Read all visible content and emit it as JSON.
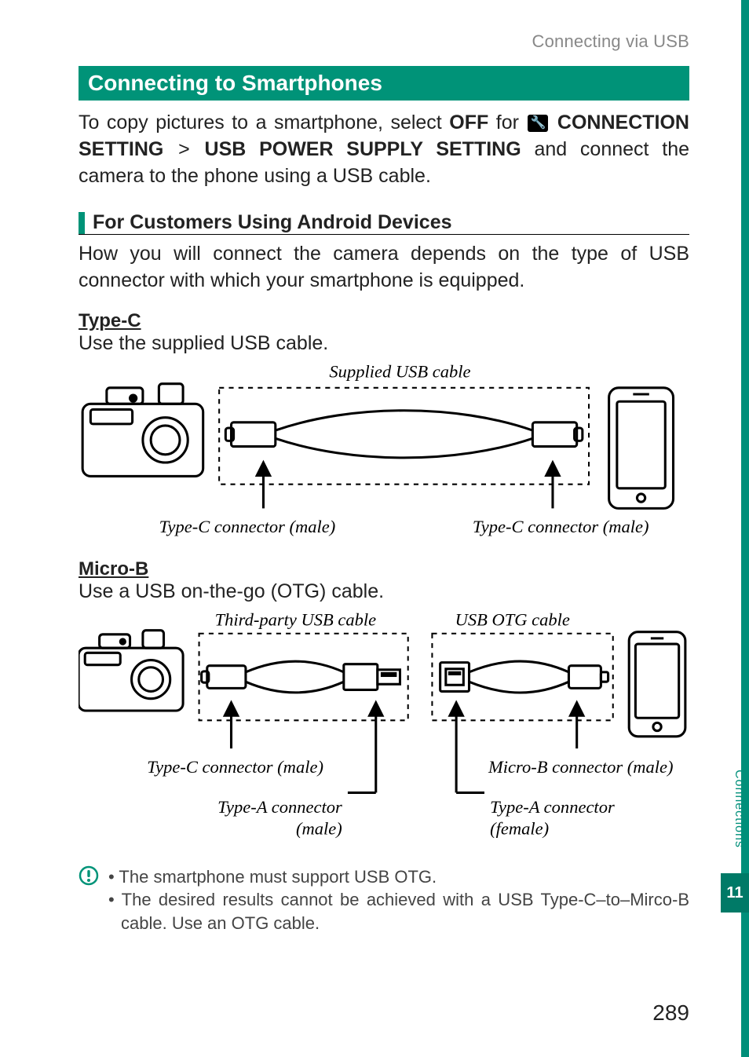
{
  "running_head": "Connecting via USB",
  "section_title": "Connecting to Smartphones",
  "intro": {
    "prefix": "To copy pictures to a smartphone, select ",
    "off": "OFF",
    "for_word": " for ",
    "menu1": "CONNECTION SETTING",
    "gt": ">",
    "menu2": "USB POWER SUPPLY SETTING",
    "suffix": " and connect the camera to the phone using a USB cable."
  },
  "android_heading": "For Customers Using Android Devices",
  "android_para": "How you will connect the camera depends on the type of USB connector with which your smartphone is equipped.",
  "type_c": {
    "title": "Type-C",
    "body": "Use the supplied USB cable.",
    "cable_label": "Supplied USB cable",
    "left_conn": "Type-C connector (male)",
    "right_conn": "Type-C connector (male)"
  },
  "micro_b": {
    "title": "Micro-B",
    "body": "Use a USB on-the-go (OTG) cable.",
    "cable1_label": "Third-party USB cable",
    "cable2_label": "USB OTG cable",
    "left_conn": "Type-C connector (male)",
    "mid_left": "Type-A connector (male)",
    "right_conn": "Micro-B connector (male)",
    "mid_right": "Type-A connector (female)"
  },
  "notes": {
    "n1": "The smartphone must support USB OTG.",
    "n2": "The desired results cannot be achieved with a USB Type-C–to–Mirco-B cable. Use an OTG cable."
  },
  "side_label": "Connections",
  "chapter_number": "11",
  "page_number": "289"
}
